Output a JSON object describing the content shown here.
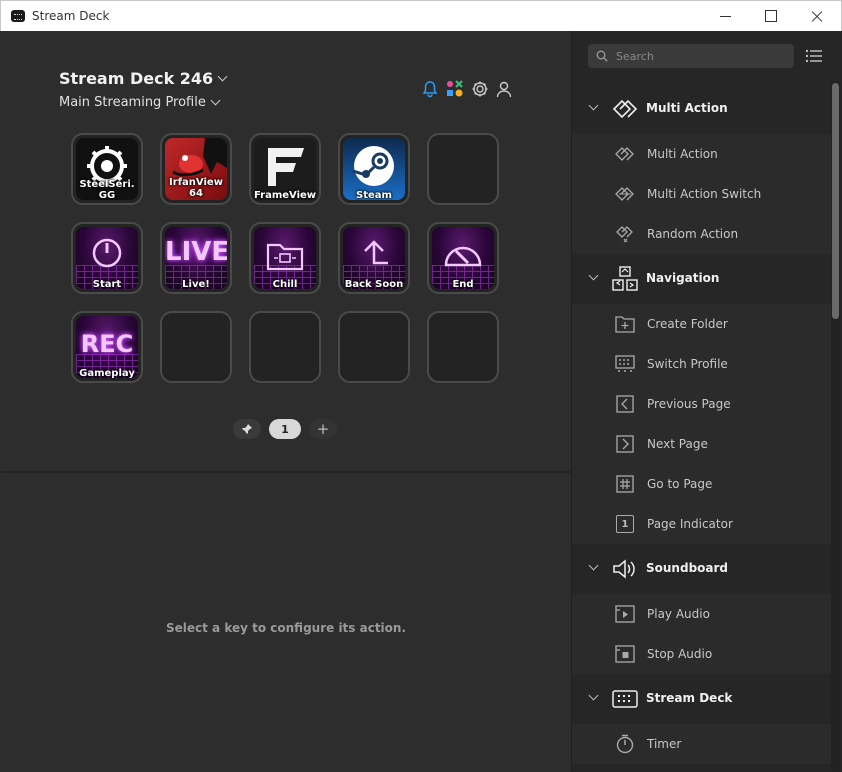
{
  "window": {
    "title": "Stream Deck"
  },
  "header": {
    "device_name": "Stream Deck 246",
    "profile_name": "Main Streaming Profile"
  },
  "keys": [
    {
      "label": "SteelSeri. GG"
    },
    {
      "label": "IrfanView 64"
    },
    {
      "label": "FrameView"
    },
    {
      "label": "Steam"
    },
    {
      "label": ""
    },
    {
      "label": "Start"
    },
    {
      "label": "Live!"
    },
    {
      "label": "Chill"
    },
    {
      "label": "Back Soon"
    },
    {
      "label": "End"
    },
    {
      "label": "Gameplay"
    },
    {
      "label": ""
    },
    {
      "label": ""
    },
    {
      "label": ""
    },
    {
      "label": ""
    }
  ],
  "key_art": {
    "live": "LIVE",
    "rec": "REC"
  },
  "pager": {
    "current_page": "1",
    "add": "+"
  },
  "config_hint": "Select a key to configure its action.",
  "search": {
    "placeholder": "Search"
  },
  "categories": {
    "multi_action": {
      "label": "Multi Action",
      "items": [
        "Multi Action",
        "Multi Action Switch",
        "Random Action"
      ]
    },
    "navigation": {
      "label": "Navigation",
      "items": [
        "Create Folder",
        "Switch Profile",
        "Previous Page",
        "Next Page",
        "Go to Page",
        "Page Indicator"
      ]
    },
    "soundboard": {
      "label": "Soundboard",
      "items": [
        "Play Audio",
        "Stop Audio"
      ]
    },
    "stream_deck": {
      "label": "Stream Deck",
      "items": [
        "Timer"
      ]
    }
  },
  "icons": {
    "page_indicator_glyph": "1"
  },
  "colors": {
    "synthwave_purple": "#b23be0",
    "steam_blue": "#1b6fc7",
    "irfan_red": "#c0282a"
  }
}
